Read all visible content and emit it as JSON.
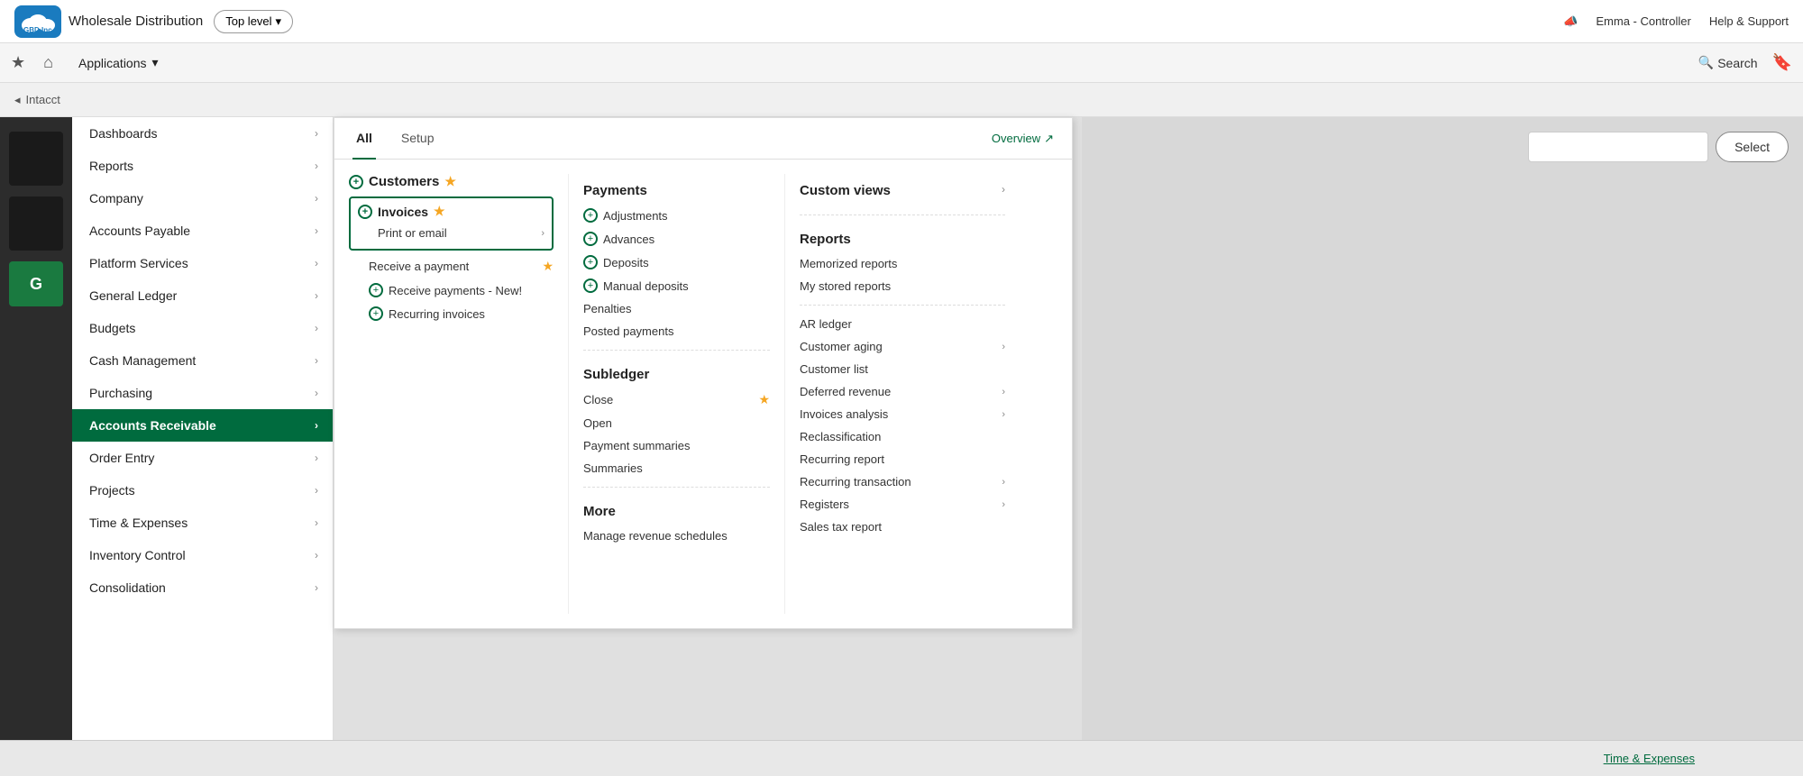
{
  "topbar": {
    "logo_text": "GBD.Inc",
    "company_name": "Wholesale Distribution",
    "level_btn": "Top level",
    "megaphone_icon": "📣",
    "user": "Emma - Controller",
    "help": "Help & Support"
  },
  "navbar": {
    "star_icon": "★",
    "home_icon": "⌂",
    "apps_label": "Applications",
    "search_label": "Search",
    "bookmark_icon": "🔖"
  },
  "breadcrumb": {
    "text": "Intacct"
  },
  "apps_menu": {
    "items": [
      {
        "label": "Dashboards",
        "active": false
      },
      {
        "label": "Reports",
        "active": false
      },
      {
        "label": "Company",
        "active": false
      },
      {
        "label": "Accounts Payable",
        "active": false
      },
      {
        "label": "Platform Services",
        "active": false
      },
      {
        "label": "General Ledger",
        "active": false
      },
      {
        "label": "Budgets",
        "active": false
      },
      {
        "label": "Cash Management",
        "active": false
      },
      {
        "label": "Purchasing",
        "active": false
      },
      {
        "label": "Accounts Receivable",
        "active": true
      },
      {
        "label": "Order Entry",
        "active": false
      },
      {
        "label": "Projects",
        "active": false
      },
      {
        "label": "Time & Expenses",
        "active": false
      },
      {
        "label": "Inventory Control",
        "active": false
      },
      {
        "label": "Consolidation",
        "active": false
      }
    ]
  },
  "mega_menu": {
    "tabs": [
      {
        "label": "All",
        "active": true
      },
      {
        "label": "Setup",
        "active": false
      }
    ],
    "overview_label": "Overview",
    "col1": {
      "customers_section": "Customers",
      "invoices_section": "Invoices",
      "print_email_item": "Print or email",
      "receive_payment_item": "Receive a payment",
      "receive_payments_new_item": "Receive payments - New!",
      "recurring_invoices_item": "Recurring invoices"
    },
    "col2": {
      "payments_header": "Payments",
      "adjustments": "Adjustments",
      "advances": "Advances",
      "deposits": "Deposits",
      "manual_deposits": "Manual deposits",
      "penalties": "Penalties",
      "posted_payments": "Posted payments",
      "subledger_header": "Subledger",
      "close": "Close",
      "open": "Open",
      "payment_summaries": "Payment summaries",
      "summaries": "Summaries",
      "more_header": "More",
      "manage_revenue": "Manage revenue schedules"
    },
    "col3": {
      "custom_views_header": "Custom views",
      "reports_header": "Reports",
      "memorized_reports": "Memorized reports",
      "my_stored_reports": "My stored reports",
      "ar_ledger": "AR ledger",
      "customer_aging": "Customer aging",
      "customer_list": "Customer list",
      "deferred_revenue": "Deferred revenue",
      "invoices_analysis": "Invoices analysis",
      "reclassification": "Reclassification",
      "recurring_report": "Recurring report",
      "recurring_transaction": "Recurring transaction",
      "registers": "Registers",
      "sales_tax_report": "Sales tax report"
    }
  },
  "select_area": {
    "dropdown_placeholder": "",
    "select_label": "Select"
  },
  "bottom": {
    "link_label": "Time & Expenses"
  }
}
